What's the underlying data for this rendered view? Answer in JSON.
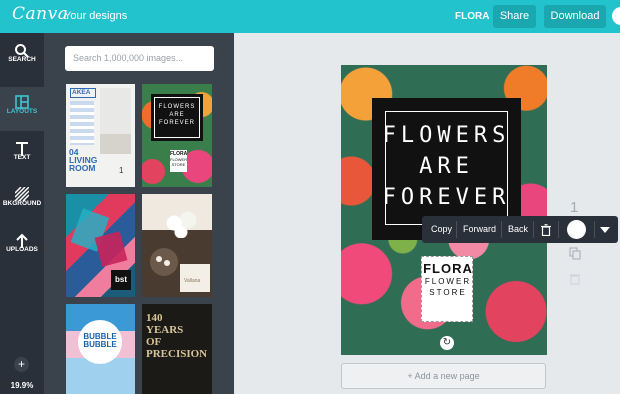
{
  "topbar": {
    "logo": "Canva",
    "your_designs": "Your designs",
    "doc_name": "FLORA",
    "share": "Share",
    "download": "Download"
  },
  "rail": {
    "items": [
      {
        "label": "SEARCH",
        "icon": "search-icon"
      },
      {
        "label": "LAYOUTS",
        "icon": "layouts-icon"
      },
      {
        "label": "TEXT",
        "icon": "text-icon"
      },
      {
        "label": "BKGROUND",
        "icon": "background-icon"
      },
      {
        "label": "UPLOADS",
        "icon": "upload-icon"
      }
    ],
    "add": "+",
    "zoom": "19.9%"
  },
  "panel": {
    "search_placeholder": "Search 1,000,000 images...",
    "layouts": [
      {
        "lines": [
          "AKEA",
          "04",
          "LIVING",
          "ROOM",
          "1"
        ]
      },
      {
        "lines": [
          "FLOWERS",
          "ARE",
          "FOREVER",
          "FLORA",
          "FLOWER",
          "STORE"
        ]
      },
      {
        "lines": [
          "bst"
        ]
      },
      {
        "lines": [
          "Vallana"
        ]
      },
      {
        "lines": [
          "BUBBLE",
          "BUBBLE"
        ]
      },
      {
        "lines": [
          "140",
          "YEARS",
          "OF",
          "PRECISION"
        ]
      }
    ]
  },
  "design": {
    "headline": [
      "FLOWERS",
      "ARE",
      "FOREVER"
    ],
    "badge": [
      "FLORA",
      "FLOWER",
      "STORE"
    ]
  },
  "canvas": {
    "page_number": "1",
    "add_page": "+ Add a new page"
  },
  "toolbar": {
    "copy": "Copy",
    "forward": "Forward",
    "back": "Back",
    "delete_icon": "trash-icon",
    "color_icon": "color-swatch",
    "more_icon": "chevron-down-icon"
  },
  "colors": {
    "brand": "#22c3cd",
    "rail": "#293039",
    "panel": "#3a424c"
  }
}
